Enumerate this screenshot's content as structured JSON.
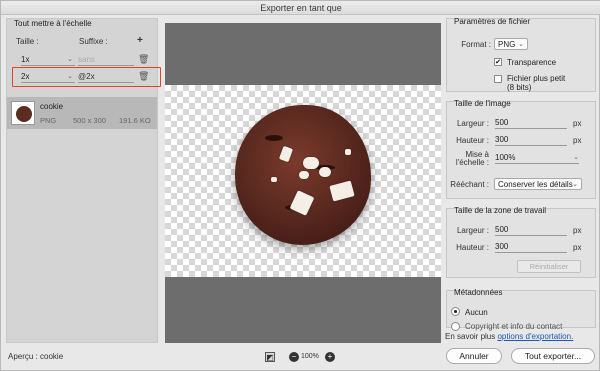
{
  "window": {
    "title": "Exporter en tant que"
  },
  "left": {
    "section_title": "Tout mettre à l'échelle",
    "size_header": "Taille :",
    "suffix_header": "Suffixe :",
    "add_label": "+",
    "rows": [
      {
        "size": "1x",
        "suffix_placeholder": "sans",
        "suffix": ""
      },
      {
        "size": "2x",
        "suffix_placeholder": "",
        "suffix": "@2x"
      }
    ],
    "asset": {
      "name": "cookie",
      "format": "PNG",
      "dimensions": "500 x 300",
      "filesize": "191.6 KO"
    },
    "preview_label": "Aperçu :",
    "preview_name": "cookie"
  },
  "zoom": {
    "value": "100%"
  },
  "file_params": {
    "title": "Paramètres de fichier",
    "format_label": "Format :",
    "format_value": "PNG",
    "transparency_label": "Transparence",
    "transparency_checked": true,
    "smaller_file_label": "Fichier plus petit",
    "smaller_file_sub": "(8 bits)",
    "smaller_file_checked": false
  },
  "image_size": {
    "title": "Taille de l'image",
    "width_label": "Largeur :",
    "width_value": "500",
    "height_label": "Hauteur :",
    "height_value": "300",
    "unit": "px",
    "scale_label_1": "Mise à",
    "scale_label_2": "l'échelle :",
    "scale_value": "100%",
    "resample_label": "Rééchant :",
    "resample_value": "Conserver les détails"
  },
  "canvas_size": {
    "title": "Taille de la zone de travail",
    "width_label": "Largeur :",
    "width_value": "500",
    "height_label": "Hauteur :",
    "height_value": "300",
    "unit": "px",
    "reset_label": "Réinitialiser"
  },
  "metadata": {
    "title": "Métadonnées",
    "opt_none": "Aucun",
    "opt_copyright": "Copyright et info du contact"
  },
  "footer": {
    "learn_more_prefix": "En savoir plus",
    "learn_more_link": "options d'exportation.",
    "cancel_label": "Annuler",
    "export_label": "Tout exporter..."
  }
}
